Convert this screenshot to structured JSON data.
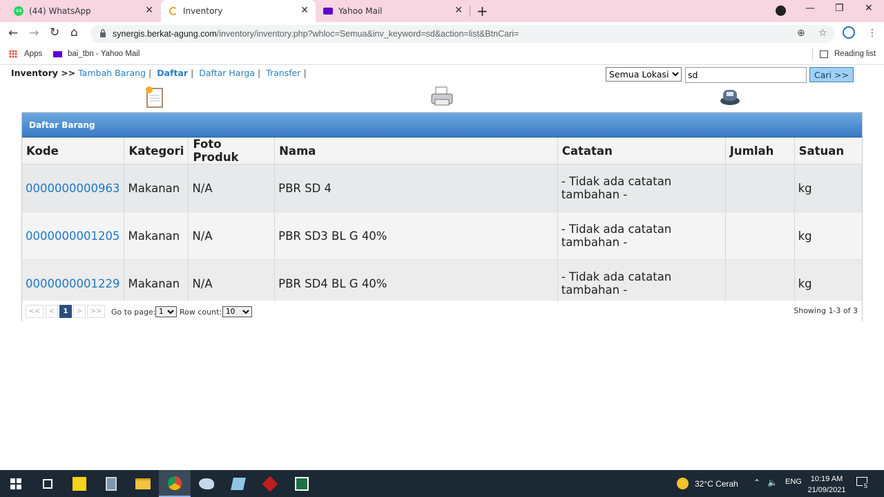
{
  "browser": {
    "tabs": [
      {
        "label": "(44) WhatsApp",
        "badge": "44"
      },
      {
        "label": "Inventory"
      },
      {
        "label": "Yahoo Mail"
      }
    ],
    "url_host": "synergis.berkat-agung.com",
    "url_path": "/inventory/inventory.php?whloc=Semua&inv_keyword=sd&action=list&BtnCari=",
    "bookmarks": {
      "apps": "Apps",
      "yahoo": "bai_tbn - Yahoo Mail",
      "reading_list": "Reading list"
    }
  },
  "nav": {
    "lead": "Inventory >>",
    "links": [
      "Tambah Barang",
      "Daftar",
      "Daftar Harga",
      "Transfer"
    ]
  },
  "search": {
    "location": "Semua Lokasi",
    "keyword": "sd",
    "button": "Cari >>"
  },
  "panel": {
    "title": "Daftar Barang",
    "columns": [
      "Kode",
      "Kategori",
      "Foto Produk",
      "Nama",
      "Catatan",
      "Jumlah",
      "Satuan"
    ],
    "rows": [
      {
        "kode": "0000000000963",
        "kategori": "Makanan",
        "foto": "N/A",
        "nama": "PBR SD 4",
        "catatan": "- Tidak ada catatan tambahan -",
        "jumlah": "",
        "satuan": "kg"
      },
      {
        "kode": "0000000001205",
        "kategori": "Makanan",
        "foto": "N/A",
        "nama": "PBR SD3 BL G 40%",
        "catatan": "- Tidak ada catatan tambahan -",
        "jumlah": "",
        "satuan": "kg"
      },
      {
        "kode": "0000000001229",
        "kategori": "Makanan",
        "foto": "N/A",
        "nama": "PBR SD4 BL G 40%",
        "catatan": "- Tidak ada catatan tambahan -",
        "jumlah": "",
        "satuan": "kg"
      }
    ],
    "pager": {
      "first": "<<",
      "prev": "<",
      "current": "1",
      "next": ">",
      "last": ">>",
      "goto_label": "Go to page:",
      "goto_value": "1",
      "rowcount_label": "Row count:",
      "rowcount_value": "10",
      "showing": "Showing 1-3 of 3"
    }
  },
  "taskbar": {
    "weather": "32°C  Cerah",
    "lang": "ENG",
    "time": "10:19 AM",
    "date": "21/09/2021",
    "notifications": "5"
  }
}
